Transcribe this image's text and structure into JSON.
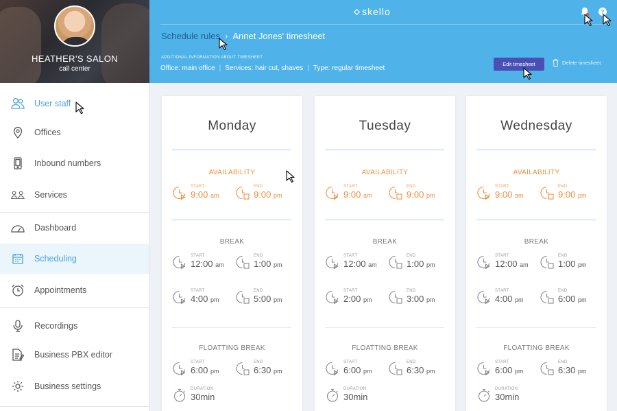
{
  "profile": {
    "name": "HEATHER'S SALON",
    "subtitle": "call center"
  },
  "sidebar": {
    "items": [
      {
        "label": "User staff",
        "icon": "users-icon",
        "state": "active"
      },
      {
        "label": "Offices",
        "icon": "location-pin-icon"
      },
      {
        "label": "Inbound numbers",
        "icon": "phone-icon"
      },
      {
        "label": "Services",
        "icon": "services-icon"
      },
      {
        "label": "Dashboard",
        "icon": "dashboard-icon"
      },
      {
        "label": "Scheduling",
        "icon": "calendar-icon",
        "state": "selected"
      },
      {
        "label": "Appointments",
        "icon": "alarm-clock-icon"
      },
      {
        "label": "Recordings",
        "icon": "microphone-icon"
      },
      {
        "label": "Business PBX editor",
        "icon": "document-edit-icon"
      },
      {
        "label": "Business settings",
        "icon": "gear-icon"
      }
    ]
  },
  "header": {
    "logo": "skello",
    "breadcrumb": {
      "parent": "Schedule rules",
      "sep": "›",
      "current": "Annet Jones' timesheet"
    },
    "info_title": "ADDITIONAL INFORMATION ABOUT TIMESHEET",
    "info": {
      "office": "Office: main office",
      "services": "Services: hair cut, shaves",
      "type": "Type: regular timesheet"
    },
    "edit_label": "Edit timesheet",
    "delete_label": "Delete timesheet",
    "help_glyph": "?"
  },
  "labels": {
    "availability": "AVAILABILITY",
    "break": "BREAK",
    "floating_break": "FLOATTING BREAK",
    "start": "START",
    "end": "END",
    "duration": "DURATION"
  },
  "days": [
    {
      "name": "Monday",
      "availability": {
        "start": "9:00",
        "start_ampm": "am",
        "end": "9:00",
        "end_ampm": "pm"
      },
      "breaks": [
        {
          "start": "12:00",
          "start_ampm": "am",
          "end": "1:00",
          "end_ampm": "pm"
        },
        {
          "start": "4:00",
          "start_ampm": "pm",
          "end": "5:00",
          "end_ampm": "pm"
        }
      ],
      "floating": {
        "start": "6:00",
        "start_ampm": "pm",
        "end": "6:30",
        "end_ampm": "pm",
        "duration": "30min"
      }
    },
    {
      "name": "Tuesday",
      "availability": {
        "start": "9:00",
        "start_ampm": "am",
        "end": "9:00",
        "end_ampm": "pm"
      },
      "breaks": [
        {
          "start": "12:00",
          "start_ampm": "am",
          "end": "1:00",
          "end_ampm": "pm"
        },
        {
          "start": "2:00",
          "start_ampm": "pm",
          "end": "3:00",
          "end_ampm": "pm"
        }
      ],
      "floating": {
        "start": "6:00",
        "start_ampm": "pm",
        "end": "6:30",
        "end_ampm": "pm",
        "duration": "30min"
      }
    },
    {
      "name": "Wednesday",
      "availability": {
        "start": "9:00",
        "start_ampm": "am",
        "end": "9:00",
        "end_ampm": "pm"
      },
      "breaks": [
        {
          "start": "12:00",
          "start_ampm": "am",
          "end": "1:00",
          "end_ampm": "pm"
        },
        {
          "start": "4:00",
          "start_ampm": "pm",
          "end": "6:00",
          "end_ampm": "pm"
        }
      ],
      "floating": {
        "start": "6:00",
        "start_ampm": "pm",
        "end": "6:30",
        "end_ampm": "pm",
        "duration": "30min"
      }
    }
  ],
  "colors": {
    "header": "#4fb3ea",
    "accent_orange": "#ef8f3e",
    "button": "#4a4fb6",
    "active": "#4aa3df"
  }
}
